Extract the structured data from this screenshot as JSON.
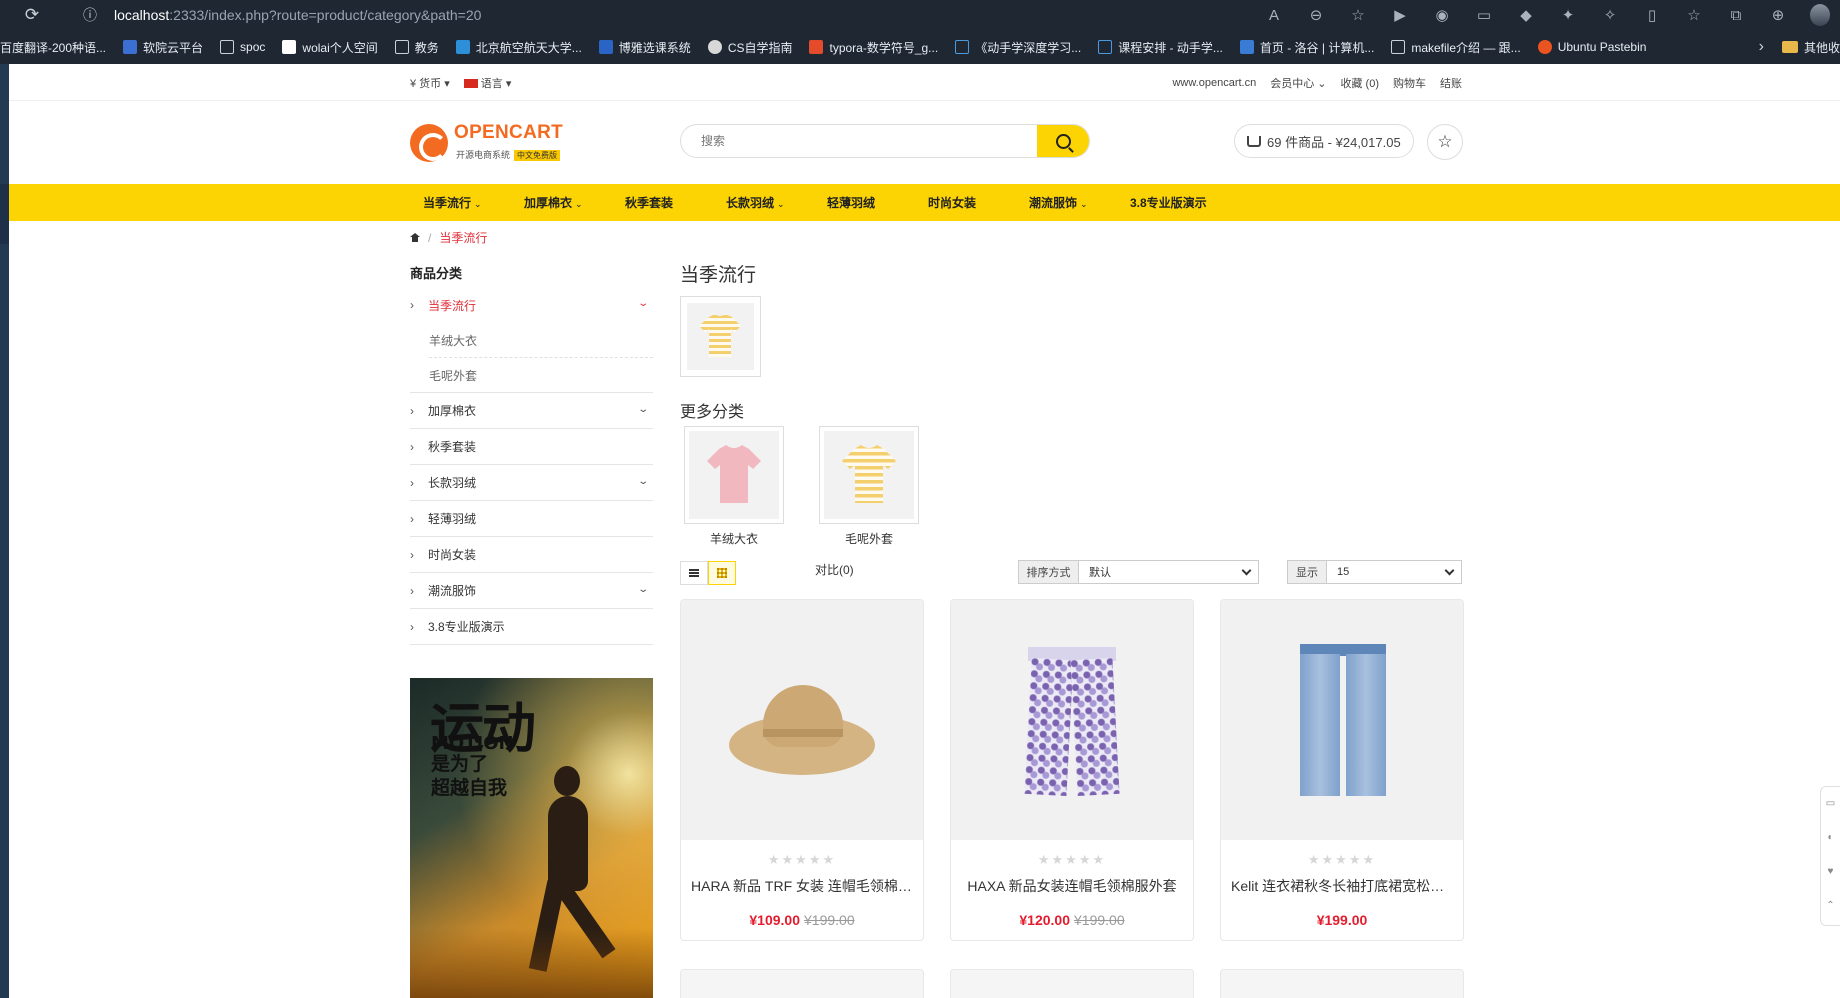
{
  "browser": {
    "url_host": "localhost",
    "url_rest": ":2333/index.php?route=product/category&path=20",
    "bookmarks": [
      "百度翻译-200种语...",
      "软院云平台",
      "spoc",
      "wolai个人空间",
      "教务",
      "北京航空航天大学...",
      "博雅选课系统",
      "CS自学指南",
      "typora-数学符号_g...",
      "《动手学深度学习...",
      "课程安排 - 动手学...",
      "首页 - 洛谷 | 计算机...",
      "makefile介绍 — 跟...",
      "Ubuntu Pastebin"
    ],
    "bookmarks_more": "其他收"
  },
  "topbar": {
    "currency": "¥ 货币",
    "language": "语言",
    "site": "www.opencart.cn",
    "account": "会员中心",
    "wishlist": "收藏 (0)",
    "cart": "购物车",
    "checkout": "结账"
  },
  "header": {
    "logo_name": "OPENCART",
    "logo_sub": "开源电商系统",
    "logo_badge": "中文免费版",
    "search_placeholder": "搜索",
    "cart_text": "69 件商品 - ¥24,017.05"
  },
  "nav": [
    {
      "label": "当季流行",
      "dropdown": "⌄"
    },
    {
      "label": "加厚棉衣",
      "dropdown": "⌄"
    },
    {
      "label": "秋季套装",
      "dropdown": ""
    },
    {
      "label": "长款羽绒",
      "dropdown": "⌄"
    },
    {
      "label": "轻薄羽绒",
      "dropdown": ""
    },
    {
      "label": "时尚女装",
      "dropdown": ""
    },
    {
      "label": "潮流服饰",
      "dropdown": "⌄"
    },
    {
      "label": "3.8专业版演示",
      "dropdown": ""
    }
  ],
  "breadcrumb": {
    "current": "当季流行"
  },
  "sidebar": {
    "title": "商品分类",
    "items": [
      {
        "label": "当季流行",
        "active": true,
        "expand": true
      },
      {
        "label": "加厚棉衣",
        "expand": true
      },
      {
        "label": "秋季套装",
        "expand": false
      },
      {
        "label": "长款羽绒",
        "expand": true
      },
      {
        "label": "轻薄羽绒",
        "expand": false
      },
      {
        "label": "时尚女装",
        "expand": false
      },
      {
        "label": "潮流服饰",
        "expand": true
      },
      {
        "label": "3.8专业版演示",
        "expand": false
      }
    ],
    "subitems": [
      "羊绒大衣",
      "毛呢外套"
    ],
    "banner": {
      "line1": "运动",
      "line2": "MOTION",
      "line3": "是为了",
      "line4": "超越自我"
    }
  },
  "category": {
    "title": "当季流行",
    "more_title": "更多分类",
    "subcategories": [
      "羊绒大衣",
      "毛呢外套"
    ]
  },
  "toolbar": {
    "compare": "对比(0)",
    "sort_label": "排序方式",
    "sort_value": "默认",
    "limit_label": "显示",
    "limit_value": "15"
  },
  "products": [
    {
      "name": "HARA 新品 TRF 女装 连帽毛领棉服外套",
      "price": "¥109.00",
      "old_price": "¥199.00",
      "rating": 0
    },
    {
      "name": "HAXA 新品女装连帽毛领棉服外套",
      "price": "¥120.00",
      "old_price": "¥199.00",
      "rating": 0
    },
    {
      "name": "Kelit 连衣裙秋冬长袖打底裙宽松中长款",
      "price": "¥199.00",
      "old_price": "",
      "rating": 0
    }
  ],
  "colors": {
    "accent": "#fcd404",
    "price": "#e31c2e",
    "link_active": "#e02f3a",
    "logo": "#f36b21"
  }
}
